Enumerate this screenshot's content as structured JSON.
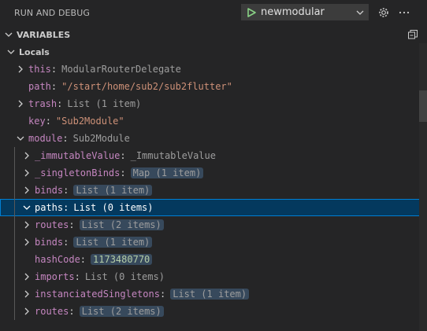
{
  "header": {
    "title": "RUN AND DEBUG",
    "config_label": "newmodular",
    "icons": [
      "play-icon",
      "chevron-down-icon",
      "gear-icon",
      "more-icon"
    ]
  },
  "section": {
    "title": "VARIABLES",
    "collapse_icon": "collapse-all-icon"
  },
  "rows": [
    {
      "depth": 0,
      "tw": "open",
      "key": "Locals",
      "value": "",
      "kind": "scope"
    },
    {
      "depth": 1,
      "tw": "closed",
      "key": "this",
      "value": "ModularRouterDelegate",
      "kind": "plain"
    },
    {
      "depth": 1,
      "tw": "none",
      "key": "path",
      "value": "\"/start/home/sub2/sub2flutter\"",
      "kind": "str"
    },
    {
      "depth": 1,
      "tw": "closed",
      "key": "trash",
      "value": "List (1 item)",
      "kind": "plain"
    },
    {
      "depth": 1,
      "tw": "none",
      "key": "key",
      "value": "\"Sub2Module\"",
      "kind": "str"
    },
    {
      "depth": 1,
      "tw": "open",
      "key": "module",
      "value": "Sub2Module",
      "kind": "plain"
    },
    {
      "depth": 2,
      "tw": "closed",
      "key": "_immutableValue",
      "value": "_ImmutableValue",
      "kind": "plain"
    },
    {
      "depth": 2,
      "tw": "closed",
      "key": "_singletonBinds",
      "value": "Map (1 item)",
      "kind": "badge"
    },
    {
      "depth": 2,
      "tw": "closed",
      "key": "binds",
      "value": "List (1 item)",
      "kind": "badge"
    },
    {
      "depth": 2,
      "tw": "open",
      "key": "paths",
      "value": "List (0 items)",
      "kind": "plain",
      "selected": true
    },
    {
      "depth": 2,
      "tw": "closed",
      "key": "routes",
      "value": "List (2 items)",
      "kind": "badge"
    },
    {
      "depth": 2,
      "tw": "closed",
      "key": "binds",
      "value": "List (1 item)",
      "kind": "badge"
    },
    {
      "depth": 2,
      "tw": "none",
      "key": "hashCode",
      "value": "1173480770",
      "kind": "num"
    },
    {
      "depth": 2,
      "tw": "closed",
      "key": "imports",
      "value": "List (0 items)",
      "kind": "plain"
    },
    {
      "depth": 2,
      "tw": "closed",
      "key": "instanciatedSingletons",
      "value": "List (1 item)",
      "kind": "badge"
    },
    {
      "depth": 2,
      "tw": "closed",
      "key": "routes",
      "value": "List (2 items)",
      "kind": "badge"
    }
  ]
}
